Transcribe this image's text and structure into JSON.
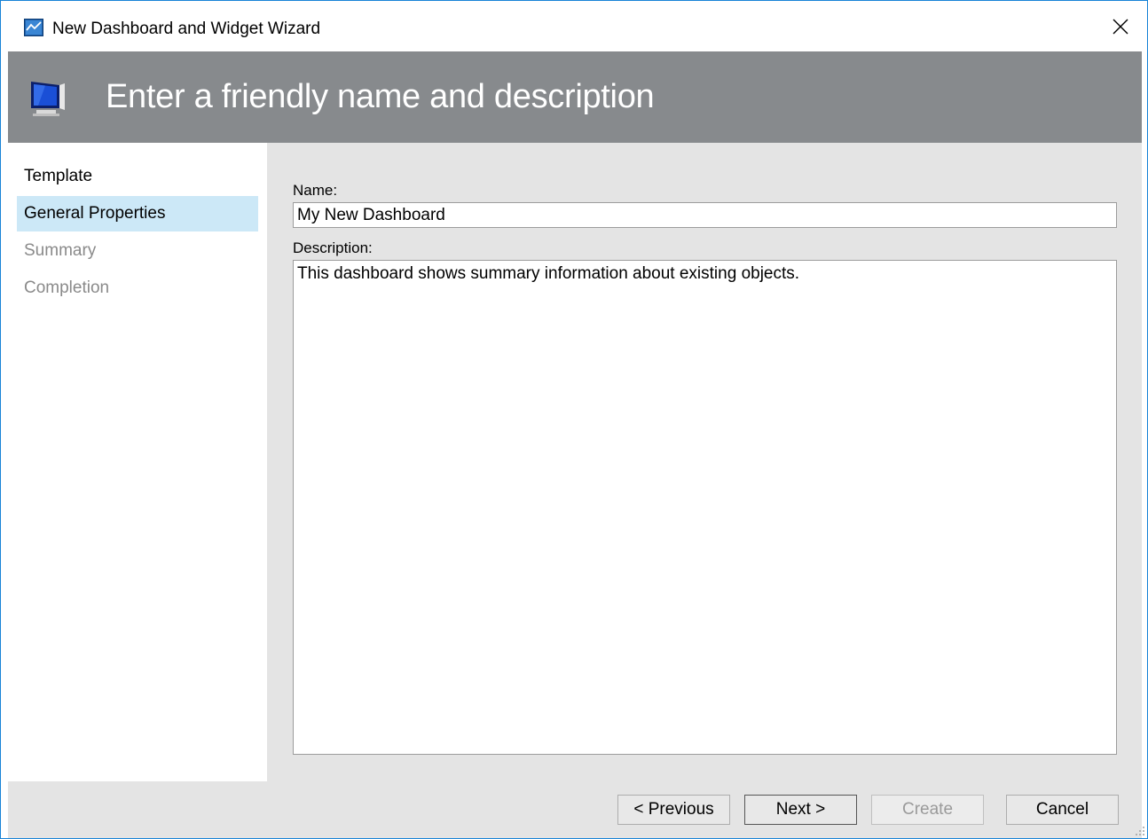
{
  "window": {
    "title": "New Dashboard and Widget Wizard"
  },
  "header": {
    "title": "Enter a friendly name and description"
  },
  "steps": [
    {
      "label": "Template",
      "state": "done"
    },
    {
      "label": "General Properties",
      "state": "active"
    },
    {
      "label": "Summary",
      "state": "disabled"
    },
    {
      "label": "Completion",
      "state": "disabled"
    }
  ],
  "form": {
    "name_label": "Name:",
    "name_value": "My New Dashboard",
    "description_label": "Description:",
    "description_value": "This dashboard shows summary information about existing objects."
  },
  "buttons": {
    "previous": "< Previous",
    "next": "Next >",
    "create": "Create",
    "cancel": "Cancel"
  },
  "icons": {
    "app": "dashboard-app-icon",
    "banner": "monitor-icon",
    "close": "close-icon"
  },
  "colors": {
    "banner_bg": "#878a8d",
    "active_step_bg": "#cce8f7",
    "window_border": "#1883d7"
  }
}
